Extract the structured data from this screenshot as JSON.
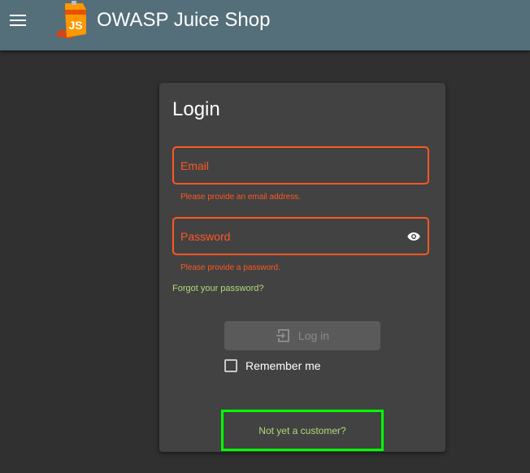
{
  "header": {
    "title": "OWASP Juice Shop",
    "menu_icon": "hamburger-menu-icon",
    "logo_icon": "juice-shop-logo",
    "logo_text": "JS",
    "background": "#546e7a"
  },
  "login": {
    "title": "Login",
    "email": {
      "label": "Email",
      "value": "",
      "error": "Please provide an email address."
    },
    "password": {
      "label": "Password",
      "value": "",
      "error": "Please provide a password.",
      "toggle_icon": "eye-icon"
    },
    "forgot_link": "Forgot your password?",
    "submit": {
      "label": "Log in",
      "icon": "login-icon",
      "disabled": true
    },
    "remember_me": {
      "label": "Remember me",
      "checked": false
    },
    "register_link": "Not yet a customer?"
  },
  "colors": {
    "error": "#ff5722",
    "link": "#b2d97a",
    "highlight": "#00ff00",
    "card": "#424242",
    "page": "#303030"
  }
}
